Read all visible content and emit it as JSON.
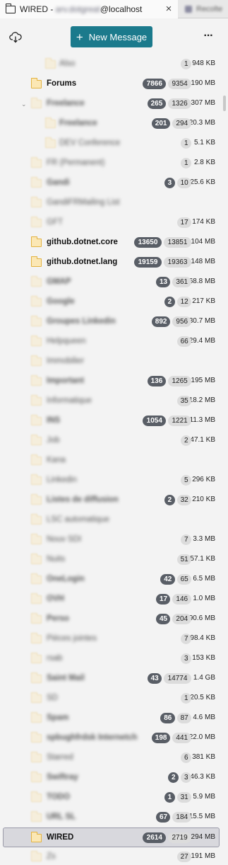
{
  "tab": {
    "title_prefix": "WIRED - ",
    "title_blurred": "arv.dotgreat",
    "title_suffix": "@localhost",
    "close": "×",
    "inactive_label": "Recolte"
  },
  "toolbar": {
    "new_message_label": "New Message",
    "plus": "+",
    "menu": "···"
  },
  "folders": [
    {
      "name": "Also",
      "blur": true,
      "indent": 2,
      "unread": "",
      "total": "1",
      "size": "948 KB"
    },
    {
      "name": "Forums",
      "blur": false,
      "indent": 1,
      "unread": "7866",
      "total": "9354",
      "size": "190 MB"
    },
    {
      "name": "Freelance",
      "blur": true,
      "indent": 1,
      "unread": "265",
      "total": "1326",
      "size": "307 MB",
      "twisty": "v"
    },
    {
      "name": "Freelance",
      "blur": true,
      "indent": 2,
      "unread": "201",
      "total": "294",
      "size": "20.3 MB"
    },
    {
      "name": "DEV Conference",
      "blur": true,
      "indent": 2,
      "unread": "",
      "total": "1",
      "size": "5.1 KB"
    },
    {
      "name": "FR (Permanent)",
      "blur": true,
      "indent": 1,
      "unread": "",
      "total": "1",
      "size": "2.8 KB"
    },
    {
      "name": "Gandi",
      "blur": true,
      "indent": 1,
      "unread": "3",
      "total": "10",
      "size": "25.6 KB"
    },
    {
      "name": "GandiFRMailing List",
      "blur": true,
      "indent": 1,
      "unread": "",
      "total": "",
      "size": ""
    },
    {
      "name": "GFT",
      "blur": true,
      "indent": 1,
      "unread": "",
      "total": "17",
      "size": "174 KB"
    },
    {
      "name": "github.dotnet.core",
      "blur": false,
      "indent": 1,
      "unread": "13650",
      "total": "13851",
      "size": "104 MB"
    },
    {
      "name": "github.dotnet.lang",
      "blur": false,
      "indent": 1,
      "unread": "19159",
      "total": "19363",
      "size": "148 MB"
    },
    {
      "name": "GMAP",
      "blur": true,
      "indent": 1,
      "unread": "13",
      "total": "361",
      "size": "68.8 MB"
    },
    {
      "name": "Google",
      "blur": true,
      "indent": 1,
      "unread": "2",
      "total": "12",
      "size": "217 KB"
    },
    {
      "name": "Groupes Linkedin",
      "blur": true,
      "indent": 1,
      "unread": "892",
      "total": "956",
      "size": "30.7 MB"
    },
    {
      "name": "Helpqueen",
      "blur": true,
      "indent": 1,
      "unread": "",
      "total": "66",
      "size": "29.4 MB"
    },
    {
      "name": "Immobilier",
      "blur": true,
      "indent": 1,
      "unread": "",
      "total": "",
      "size": ""
    },
    {
      "name": "Important",
      "blur": true,
      "indent": 1,
      "unread": "136",
      "total": "1265",
      "size": "195 MB"
    },
    {
      "name": "Informatique",
      "blur": true,
      "indent": 1,
      "unread": "",
      "total": "35",
      "size": "18.2 MB"
    },
    {
      "name": "INS",
      "blur": true,
      "indent": 1,
      "unread": "1054",
      "total": "1221",
      "size": "11.3 MB"
    },
    {
      "name": "Job",
      "blur": true,
      "indent": 1,
      "unread": "",
      "total": "2",
      "size": "47.1 KB"
    },
    {
      "name": "Kana",
      "blur": true,
      "indent": 1,
      "unread": "",
      "total": "",
      "size": ""
    },
    {
      "name": "Linkedin",
      "blur": true,
      "indent": 1,
      "unread": "",
      "total": "5",
      "size": "296 KB"
    },
    {
      "name": "Listes de diffusion",
      "blur": true,
      "indent": 1,
      "unread": "2",
      "total": "32",
      "size": "210 KB"
    },
    {
      "name": "LSC automatique",
      "blur": true,
      "indent": 1,
      "unread": "",
      "total": "",
      "size": ""
    },
    {
      "name": "Nouv SDI",
      "blur": true,
      "indent": 1,
      "unread": "",
      "total": "7",
      "size": "3.3 MB"
    },
    {
      "name": "Nuits",
      "blur": true,
      "indent": 1,
      "unread": "",
      "total": "51",
      "size": "57.1 KB"
    },
    {
      "name": "OneLogin",
      "blur": true,
      "indent": 1,
      "unread": "42",
      "total": "65",
      "size": "6.5 MB"
    },
    {
      "name": "OVH",
      "blur": true,
      "indent": 1,
      "unread": "17",
      "total": "146",
      "size": "1.0 MB"
    },
    {
      "name": "Perso",
      "blur": true,
      "indent": 1,
      "unread": "45",
      "total": "204",
      "size": "90.6 MB"
    },
    {
      "name": "Pièces jointes",
      "blur": true,
      "indent": 1,
      "unread": "",
      "total": "7",
      "size": "98.4 KB"
    },
    {
      "name": "rsab",
      "blur": true,
      "indent": 1,
      "unread": "",
      "total": "3",
      "size": "153 KB"
    },
    {
      "name": "Saint Mail",
      "blur": true,
      "indent": 1,
      "unread": "43",
      "total": "14774",
      "size": "1.4 GB"
    },
    {
      "name": "SD",
      "blur": true,
      "indent": 1,
      "unread": "",
      "total": "1",
      "size": "20.5 KB"
    },
    {
      "name": "Spam",
      "blur": true,
      "indent": 1,
      "unread": "86",
      "total": "87",
      "size": "4.6 MB"
    },
    {
      "name": "spbughfrdsk Internetch",
      "blur": true,
      "indent": 1,
      "unread": "198",
      "total": "441",
      "size": "22.0 MB"
    },
    {
      "name": "Starred",
      "blur": true,
      "indent": 1,
      "unread": "",
      "total": "6",
      "size": "381 KB"
    },
    {
      "name": "Swiftray",
      "blur": true,
      "indent": 1,
      "unread": "2",
      "total": "3",
      "size": "46.3 KB"
    },
    {
      "name": "TODO",
      "blur": true,
      "indent": 1,
      "unread": "1",
      "total": "31",
      "size": "5.9 MB"
    },
    {
      "name": "URL SL",
      "blur": true,
      "indent": 1,
      "unread": "67",
      "total": "184",
      "size": "15.5 MB"
    },
    {
      "name": "WIRED",
      "blur": false,
      "indent": 1,
      "unread": "2614",
      "total": "2719",
      "size": "294 MB",
      "selected": true
    },
    {
      "name": "Zs",
      "blur": true,
      "indent": 1,
      "unread": "",
      "total": "27",
      "size": "191 MB"
    }
  ],
  "colors": {
    "accent": "#1b7a8c",
    "unread_pill": "#595e66",
    "total_pill": "#dcdcdc",
    "folder_icon": "#e3b341",
    "folder_fill": "#fbe7b4"
  },
  "icons": {
    "tab_icon": "folder-icon",
    "get_mail": "cloud-download-icon",
    "menu": "more-dots-icon",
    "folder": "folder-icon",
    "twisty": "chevron-down-icon"
  }
}
